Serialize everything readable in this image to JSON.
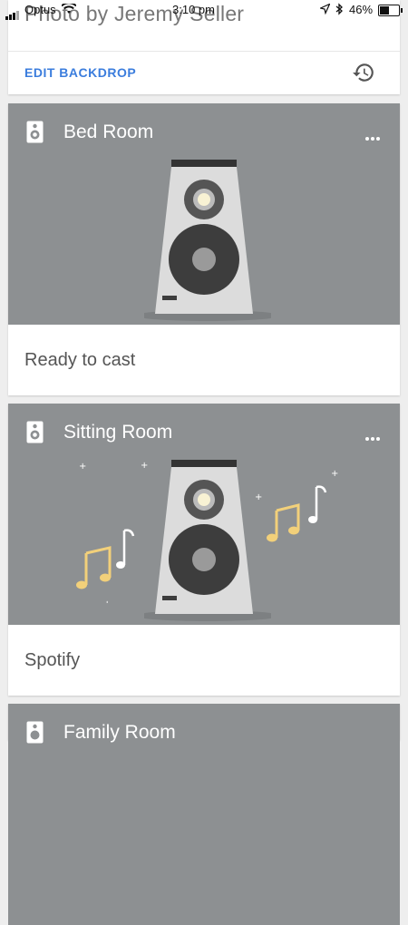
{
  "status_bar": {
    "carrier": "Optus",
    "time": "3:10 pm",
    "battery_percent": "46%",
    "battery_level": 0.46
  },
  "backdrop": {
    "photo_credit": "Photo by Jeremy Seller",
    "edit_label": "EDIT BACKDROP",
    "history_icon": "history-icon"
  },
  "devices": [
    {
      "name": "Bed Room",
      "status": "Ready to cast",
      "icon": "speaker-icon",
      "playing": false
    },
    {
      "name": "Sitting Room",
      "status": "Spotify",
      "icon": "speaker-icon",
      "playing": true
    },
    {
      "name": "Family Room",
      "status": "",
      "icon": "speaker-icon",
      "playing": false
    }
  ],
  "colors": {
    "card_backdrop": "#8d9092",
    "link_blue": "#3b7ddd",
    "note_yellow": "#f2d07a"
  }
}
